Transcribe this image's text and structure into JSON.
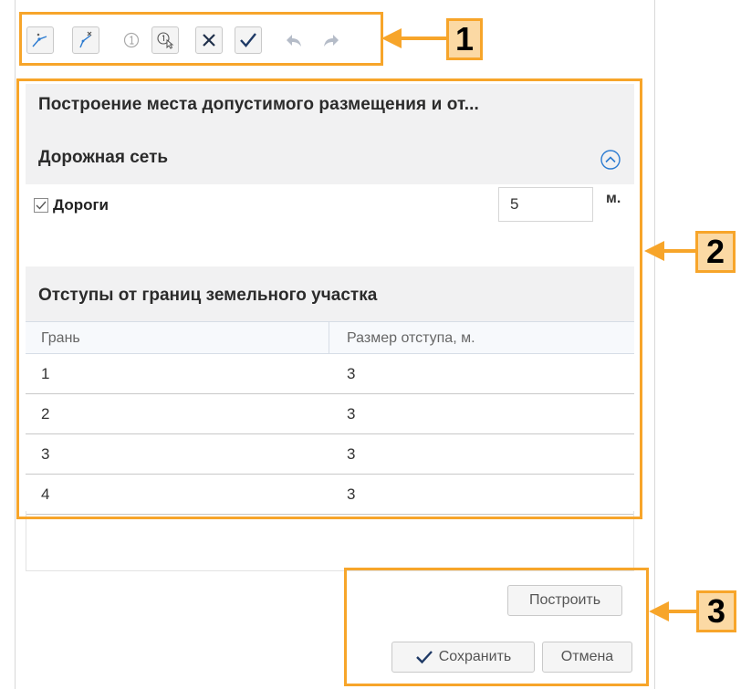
{
  "toolbar": {
    "buttons": [
      {
        "icon": "draw-line-icon",
        "enabled": true
      },
      {
        "icon": "delete-line-icon",
        "enabled": true
      },
      {
        "icon": "point-number-icon",
        "enabled": false
      },
      {
        "icon": "point-select-icon",
        "enabled": true
      },
      {
        "icon": "close-icon",
        "enabled": true
      },
      {
        "icon": "check-icon",
        "enabled": true
      },
      {
        "icon": "undo-icon",
        "enabled": false
      },
      {
        "icon": "redo-icon",
        "enabled": false
      }
    ]
  },
  "dialog": {
    "title": "Построение места допустимого размещения и от...",
    "road_network": {
      "title": "Дорожная сеть",
      "roads_label": "Дороги",
      "roads_checked": true,
      "roads_value": "5",
      "unit": "м."
    },
    "offsets": {
      "title": "Отступы от границ земельного участка",
      "columns": [
        "Грань",
        "Размер отступа, м."
      ],
      "rows": [
        [
          "1",
          "3"
        ],
        [
          "2",
          "3"
        ],
        [
          "3",
          "3"
        ],
        [
          "4",
          "3"
        ]
      ]
    }
  },
  "buttons": {
    "build": "Построить",
    "save": "Сохранить",
    "cancel": "Отмена"
  },
  "callouts": {
    "one": "1",
    "two": "2",
    "three": "3"
  },
  "colors": {
    "highlight": "#f7a52a",
    "callout_fill": "#fbd9a4",
    "accent_blue": "#2b7bd1"
  }
}
